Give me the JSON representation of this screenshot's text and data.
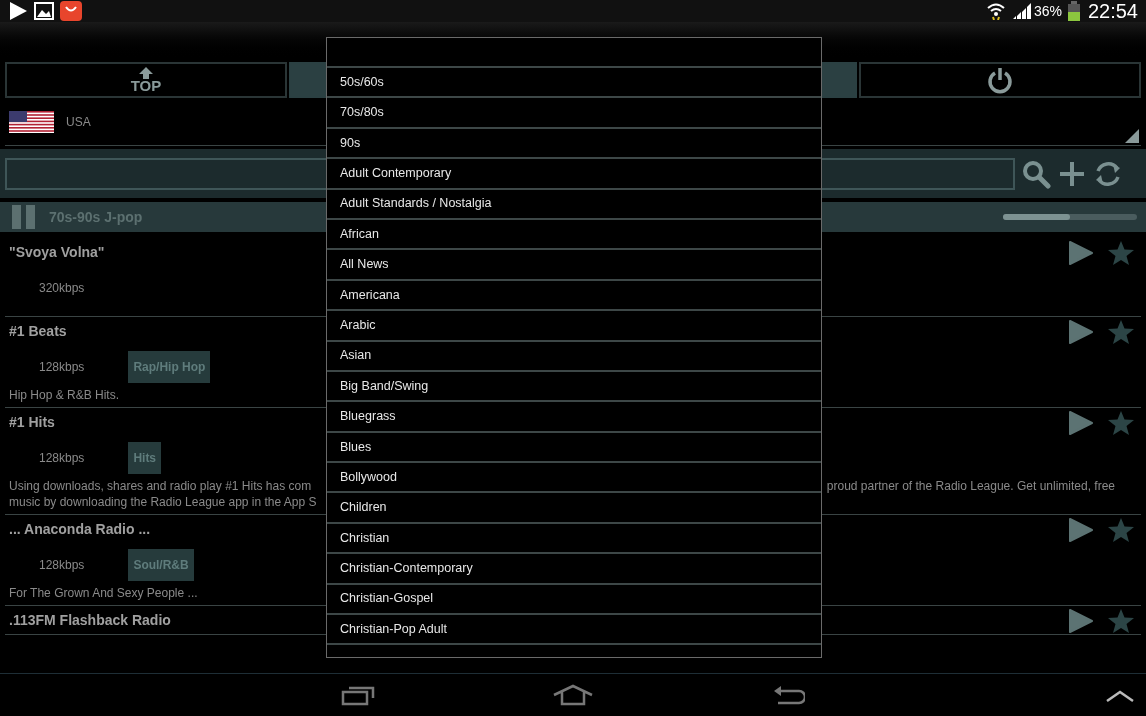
{
  "status_bar": {
    "battery": "36%",
    "time": "22:54"
  },
  "tabs": [
    {
      "kind": "top",
      "label": "TOP",
      "selected": false
    },
    {
      "kind": "blank",
      "selected": true
    },
    {
      "kind": "power",
      "selected": false
    }
  ],
  "country": {
    "name": "USA"
  },
  "now_playing": {
    "title": "70s-90s J-pop",
    "level": 0.5,
    "playing": true
  },
  "stations": [
    {
      "name": "\"Svoya Volna\"",
      "bitrate": "320kbps"
    },
    {
      "name": "#1 Beats",
      "bitrate": "128kbps",
      "genre": "Rap/Hip Hop",
      "description": "Hip Hop & R&B Hits."
    },
    {
      "name": "#1 Hits",
      "bitrate": "128kbps",
      "genre": "Hits",
      "description": "Using downloads, shares and radio play #1 Hits has com",
      "description_2": "proud partner of the Radio League. Get unlimited, free",
      "description_3": "music by downloading the Radio League app in the App S"
    },
    {
      "name": "... Anaconda Radio ...",
      "bitrate": "128kbps",
      "genre": "Soul/R&B",
      "description": "For The Grown And Sexy People ..."
    },
    {
      "name": ".113FM Flashback Radio"
    }
  ],
  "genre_menu": {
    "items": [
      "50s/60s",
      "70s/80s",
      "90s",
      "Adult Contemporary",
      "Adult Standards / Nostalgia",
      "African",
      "All News",
      "Americana",
      "Arabic",
      "Asian",
      "Big Band/Swing",
      "Bluegrass",
      "Blues",
      "Bollywood",
      "Children",
      "Christian",
      "Christian-Contemporary",
      "Christian-Gospel",
      "Christian-Pop Adult"
    ]
  }
}
